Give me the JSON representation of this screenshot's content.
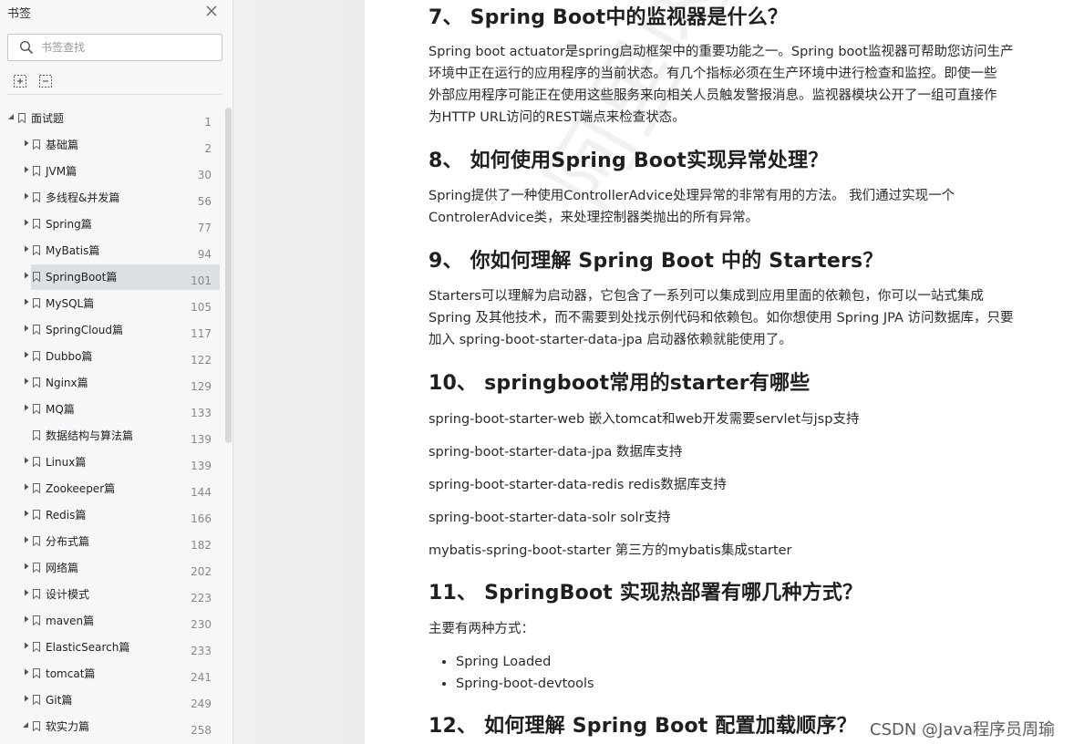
{
  "sidebar": {
    "title": "书签",
    "search_placeholder": "书签查找",
    "tools": [
      "expand-all-icon",
      "collapse-all-icon"
    ],
    "items": [
      {
        "label": "面试题",
        "page": "1",
        "level": 0,
        "state": "open",
        "selected": false
      },
      {
        "label": "基础篇",
        "page": "2",
        "level": 1,
        "state": "closed",
        "selected": false
      },
      {
        "label": "JVM篇",
        "page": "30",
        "level": 1,
        "state": "closed",
        "selected": false
      },
      {
        "label": "多线程&并发篇",
        "page": "56",
        "level": 1,
        "state": "closed",
        "selected": false
      },
      {
        "label": "Spring篇",
        "page": "77",
        "level": 1,
        "state": "closed",
        "selected": false
      },
      {
        "label": "MyBatis篇",
        "page": "94",
        "level": 1,
        "state": "closed",
        "selected": false
      },
      {
        "label": "SpringBoot篇",
        "page": "101",
        "level": 1,
        "state": "closed",
        "selected": true
      },
      {
        "label": "MySQL篇",
        "page": "105",
        "level": 1,
        "state": "closed",
        "selected": false
      },
      {
        "label": "SpringCloud篇",
        "page": "117",
        "level": 1,
        "state": "closed",
        "selected": false
      },
      {
        "label": "Dubbo篇",
        "page": "122",
        "level": 1,
        "state": "closed",
        "selected": false
      },
      {
        "label": "Nginx篇",
        "page": "129",
        "level": 1,
        "state": "closed",
        "selected": false
      },
      {
        "label": "MQ篇",
        "page": "133",
        "level": 1,
        "state": "closed",
        "selected": false
      },
      {
        "label": "数据结构与算法篇",
        "page": "139",
        "level": 1,
        "state": "leaf",
        "selected": false
      },
      {
        "label": "Linux篇",
        "page": "139",
        "level": 1,
        "state": "closed",
        "selected": false
      },
      {
        "label": "Zookeeper篇",
        "page": "144",
        "level": 1,
        "state": "closed",
        "selected": false
      },
      {
        "label": "Redis篇",
        "page": "166",
        "level": 1,
        "state": "closed",
        "selected": false
      },
      {
        "label": "分布式篇",
        "page": "182",
        "level": 1,
        "state": "closed",
        "selected": false
      },
      {
        "label": "网络篇",
        "page": "202",
        "level": 1,
        "state": "closed",
        "selected": false
      },
      {
        "label": "设计模式",
        "page": "223",
        "level": 1,
        "state": "closed",
        "selected": false
      },
      {
        "label": "maven篇",
        "page": "230",
        "level": 1,
        "state": "closed",
        "selected": false
      },
      {
        "label": "ElasticSearch篇",
        "page": "233",
        "level": 1,
        "state": "closed",
        "selected": false
      },
      {
        "label": "tomcat篇",
        "page": "241",
        "level": 1,
        "state": "closed",
        "selected": false
      },
      {
        "label": "Git篇",
        "page": "249",
        "level": 1,
        "state": "closed",
        "selected": false
      },
      {
        "label": "软实力篇",
        "page": "258",
        "level": 1,
        "state": "open",
        "selected": false
      }
    ]
  },
  "document": {
    "h7": "7、 Spring Boot中的监视器是什么？",
    "p7": [
      "Spring boot actuator是spring启动框架中的重要功能之一。Spring boot监视器可帮助您访问生产",
      "环境中正在运行的应用程序的当前状态。有几个指标必须在生产环境中进行检查和监控。即使一些",
      "外部应用程序可能正在使用这些服务来向相关人员触发警报消息。监视器模块公开了一组可直接作",
      "为HTTP URL访问的REST端点来检查状态。"
    ],
    "h8": "8、 如何使用Spring Boot实现异常处理？",
    "p8": [
      "Spring提供了一种使用ControllerAdvice处理异常的非常有用的方法。 我们通过实现一个",
      "ControlerAdvice类，来处理控制器类抛出的所有异常。"
    ],
    "h9": "9、 你如何理解 Spring Boot 中的 Starters？",
    "p9": [
      "Starters可以理解为启动器，它包含了一系列可以集成到应用里面的依赖包，你可以一站式集成",
      "Spring 及其他技术，而不需要到处找示例代码和依赖包。如你想使用 Spring JPA 访问数据库，只要",
      "加入 spring-boot-starter-data-jpa 启动器依赖就能使用了。"
    ],
    "h10": "10、 springboot常用的starter有哪些",
    "starters": [
      "spring-boot-starter-web 嵌入tomcat和web开发需要servlet与jsp支持",
      "spring-boot-starter-data-jpa 数据库支持",
      "spring-boot-starter-data-redis redis数据库支持",
      "spring-boot-starter-data-solr solr支持",
      "mybatis-spring-boot-starter 第三方的mybatis集成starter"
    ],
    "h11": "11、 SpringBoot 实现热部署有哪几种方式？",
    "p11": "主要有两种方式：",
    "list11": [
      "Spring Loaded",
      "Spring-boot-devtools"
    ],
    "h12": "12、 如何理解 Spring Boot 配置加载顺序？",
    "watermark": "阿里内部资料",
    "csdn": "CSDN @Java程序员周瑜"
  }
}
